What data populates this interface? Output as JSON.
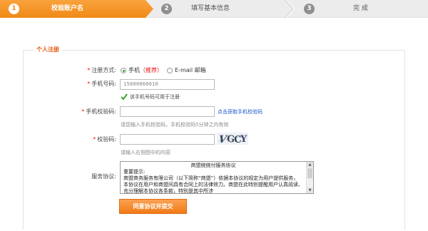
{
  "steps": [
    {
      "num": "1",
      "label": "校验账户名",
      "active": true
    },
    {
      "num": "2",
      "label": "填写基本信息",
      "active": false
    },
    {
      "num": "3",
      "label": "完  成",
      "active": false
    }
  ],
  "section": {
    "title": "个人注册"
  },
  "form": {
    "reg_method": {
      "label": "注册方式:",
      "options": [
        {
          "text": "手机",
          "extra": "（推荐）",
          "checked": true
        },
        {
          "text": "E-mail 邮箱",
          "checked": false
        }
      ]
    },
    "phone": {
      "label": "手机号码:",
      "value": "15888868616",
      "ok_hint": "该手机号码可用于注册"
    },
    "sms_code": {
      "label": "手机校验码:",
      "value": "",
      "link": "点击获取手机校验码",
      "hint": "请您输入手机校验码，手机校验码5分钟之内有效"
    },
    "captcha": {
      "label": "校验码:",
      "value": "",
      "image_text": "VGCY",
      "hint": "请输入右侧图中的内容"
    },
    "agreement": {
      "label": "服务协议:",
      "title": "商盟统统付服务协议",
      "heading": "重要提示:",
      "body": "商盟商务服务有限公司（以下简称“商盟”）依据本协议的规定为用户提供服务，本协议在用户和商盟间具有合同上的法律效力。商盟在此特别提醒用户认真阅读、充分理解本协议各条款，特别是其中所涉"
    },
    "submit_label": "同意协议并提交"
  },
  "colors": {
    "accent": "#f08a17",
    "required": "#ee1111",
    "link": "#1a55c9"
  }
}
